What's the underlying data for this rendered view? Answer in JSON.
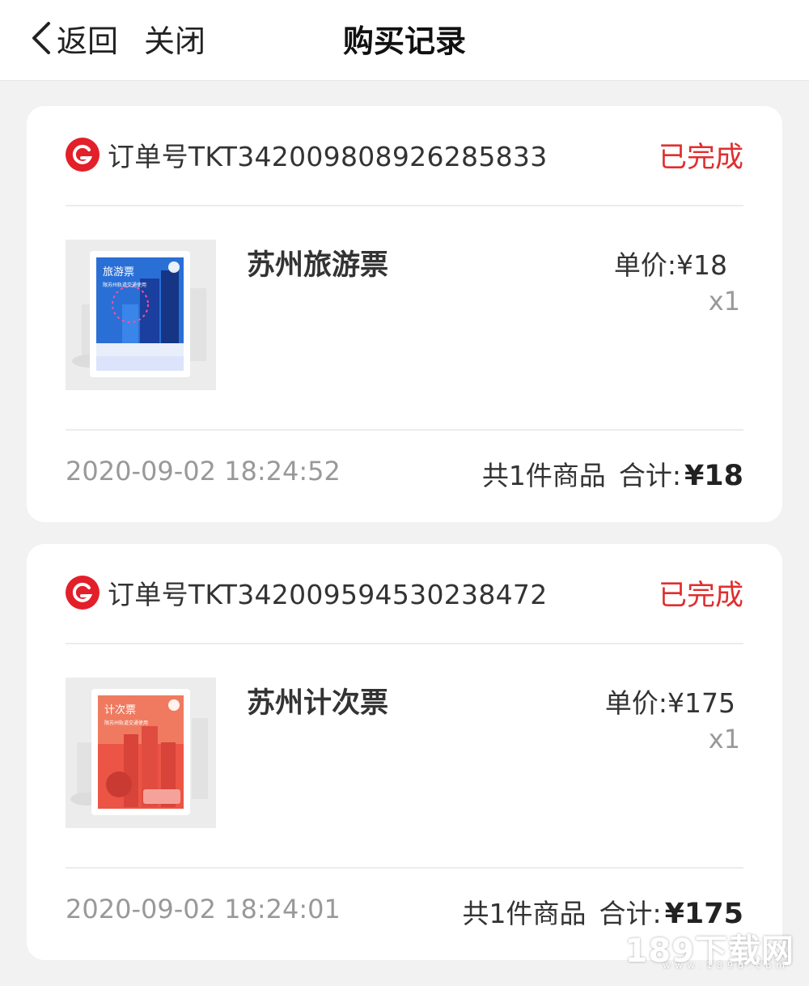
{
  "header": {
    "back_label": "返回",
    "close_label": "关闭",
    "title": "购买记录"
  },
  "orders": [
    {
      "order_no": "订单号TKT342009808926285833",
      "status": "已完成",
      "product_name": "苏州旅游票",
      "unit_price": "单价:¥18",
      "quantity": "x1",
      "time": "2020-09-02 18:24:52",
      "count_text": "共1件商品",
      "total_label": "合计:",
      "total_amount": "¥18",
      "ticket_label": "旅游票",
      "ticket_sub": "限苏州轨道交通使用",
      "ticket_color": "#2a6fd6"
    },
    {
      "order_no": "订单号TKT342009594530238472",
      "status": "已完成",
      "product_name": "苏州计次票",
      "unit_price": "单价:¥175",
      "quantity": "x1",
      "time": "2020-09-02 18:24:01",
      "count_text": "共1件商品",
      "total_label": "合计:",
      "total_amount": "¥175",
      "ticket_label": "计次票",
      "ticket_sub": "限苏州轨道交通使用",
      "ticket_color": "#ec5445"
    }
  ],
  "watermark": {
    "text": "189下载网",
    "sub": "www.189d.com"
  },
  "colors": {
    "status": "#e02e2e",
    "brand": "#e31f2a"
  }
}
